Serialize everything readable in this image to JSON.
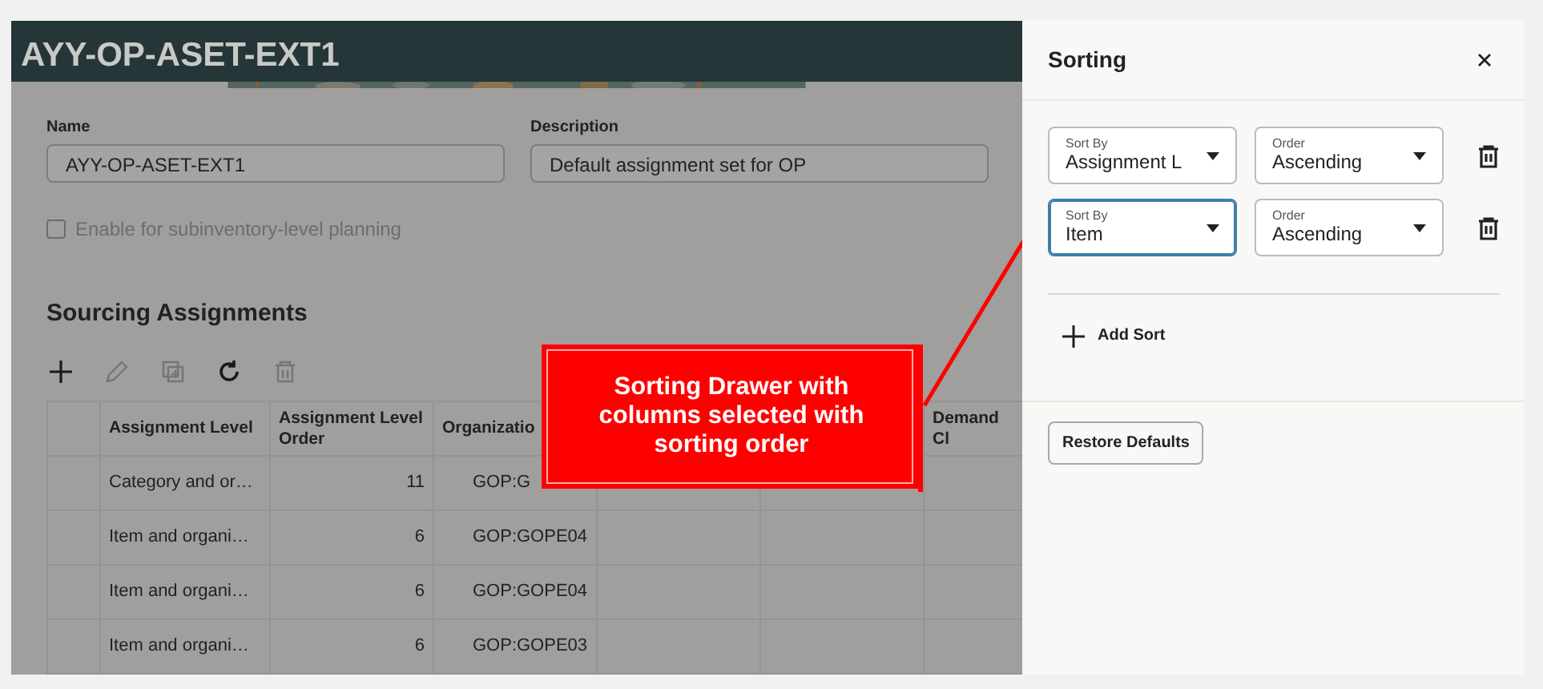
{
  "page": {
    "title": "AYY-OP-ASET-EXT1",
    "fields": [
      {
        "label": "Name",
        "value": "AYY-OP-ASET-EXT1"
      },
      {
        "label": "Description",
        "value": "Default assignment set for OP"
      }
    ],
    "checkbox": {
      "label": "Enable for subinventory-level planning",
      "checked": false,
      "disabled": true
    },
    "section_title": "Sourcing Assignments",
    "toolbar": [
      {
        "kind": "add",
        "disabled": false
      },
      {
        "kind": "edit",
        "disabled": true
      },
      {
        "kind": "duplicate",
        "disabled": true
      },
      {
        "kind": "refresh",
        "disabled": false
      },
      {
        "kind": "delete",
        "disabled": true
      }
    ],
    "table": {
      "columns": [
        {
          "label": "Assignment Level"
        },
        {
          "label": "Assignment Level Order"
        },
        {
          "label": "Organizatio"
        },
        {},
        {},
        {
          "label": "Demand Cl"
        }
      ],
      "rows": [
        {
          "assignment_level": "Category and or…",
          "order": "11",
          "organization": "GOP:G"
        },
        {
          "assignment_level": "Item and organi…",
          "order": "6",
          "organization": "GOP:GOPE04"
        },
        {
          "assignment_level": "Item and organi…",
          "order": "6",
          "organization": "GOP:GOPE04"
        },
        {
          "assignment_level": "Item and organi…",
          "order": "6",
          "organization": "GOP:GOPE03"
        }
      ]
    }
  },
  "drawer": {
    "title": "Sorting",
    "sorts": [
      {
        "sort_by_label": "Sort By",
        "sort_by": "Assignment L",
        "order_label": "Order",
        "order": "Ascending",
        "focused": false
      },
      {
        "sort_by_label": "Sort By",
        "sort_by": "Item",
        "order_label": "Order",
        "order": "Ascending",
        "focused": true
      }
    ],
    "add_sort": "Add Sort",
    "restore": "Restore Defaults"
  },
  "callout": {
    "text": "Sorting Drawer with columns selected with sorting order"
  }
}
